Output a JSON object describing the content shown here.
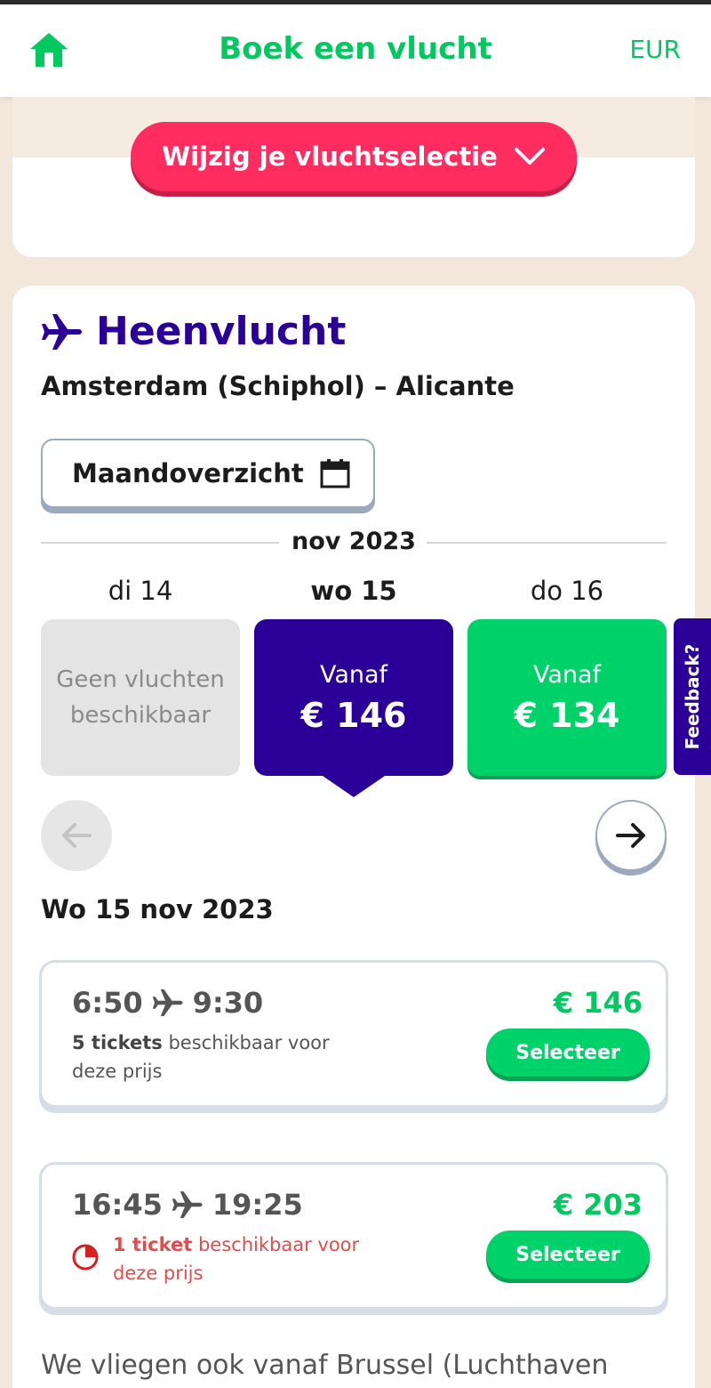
{
  "header": {
    "title": "Boek een vlucht",
    "currency": "EUR",
    "home_icon": "home-icon",
    "brand_color": "#00c95f"
  },
  "change_selection": {
    "label": "Wijzig je vluchtselectie",
    "icon": "chevron-down-icon",
    "color": "#ff2d5f"
  },
  "outbound": {
    "title": "Heenvlucht",
    "icon": "plane-icon",
    "route": "Amsterdam (Schiphol) – Alicante",
    "month_overview_label": "Maandoverzicht",
    "month_label": "nov 2023",
    "days": [
      {
        "label": "di 14",
        "text1": "Geen vluchten",
        "text2": "beschikbaar",
        "state": "unavailable"
      },
      {
        "label": "wo 15",
        "from": "Vanaf",
        "price": "€ 146",
        "state": "selected"
      },
      {
        "label": "do 16",
        "from": "Vanaf",
        "price": "€ 134",
        "state": "cheaper"
      }
    ],
    "selected_date": "Wo 15 nov 2023",
    "flights": [
      {
        "depart": "6:50",
        "arrive": "9:30",
        "tickets_count": "5 tickets",
        "tickets_text": " beschikbaar voor deze prijs",
        "price": "€ 146",
        "select_label": "Selecteer"
      },
      {
        "depart": "16:45",
        "arrive": "19:25",
        "tickets_count": "1 ticket",
        "tickets_text": " beschikbaar voor deze prijs",
        "price": "€ 203",
        "select_label": "Selecteer"
      }
    ],
    "also_from_text": "We vliegen ook vanaf Brussel (Luchthaven"
  },
  "feedback": {
    "label": "Feedback?"
  },
  "colors": {
    "accent_purple": "#2a0099",
    "green": "#00d26a",
    "red": "#e84a4a",
    "background": "#f3e7db"
  }
}
